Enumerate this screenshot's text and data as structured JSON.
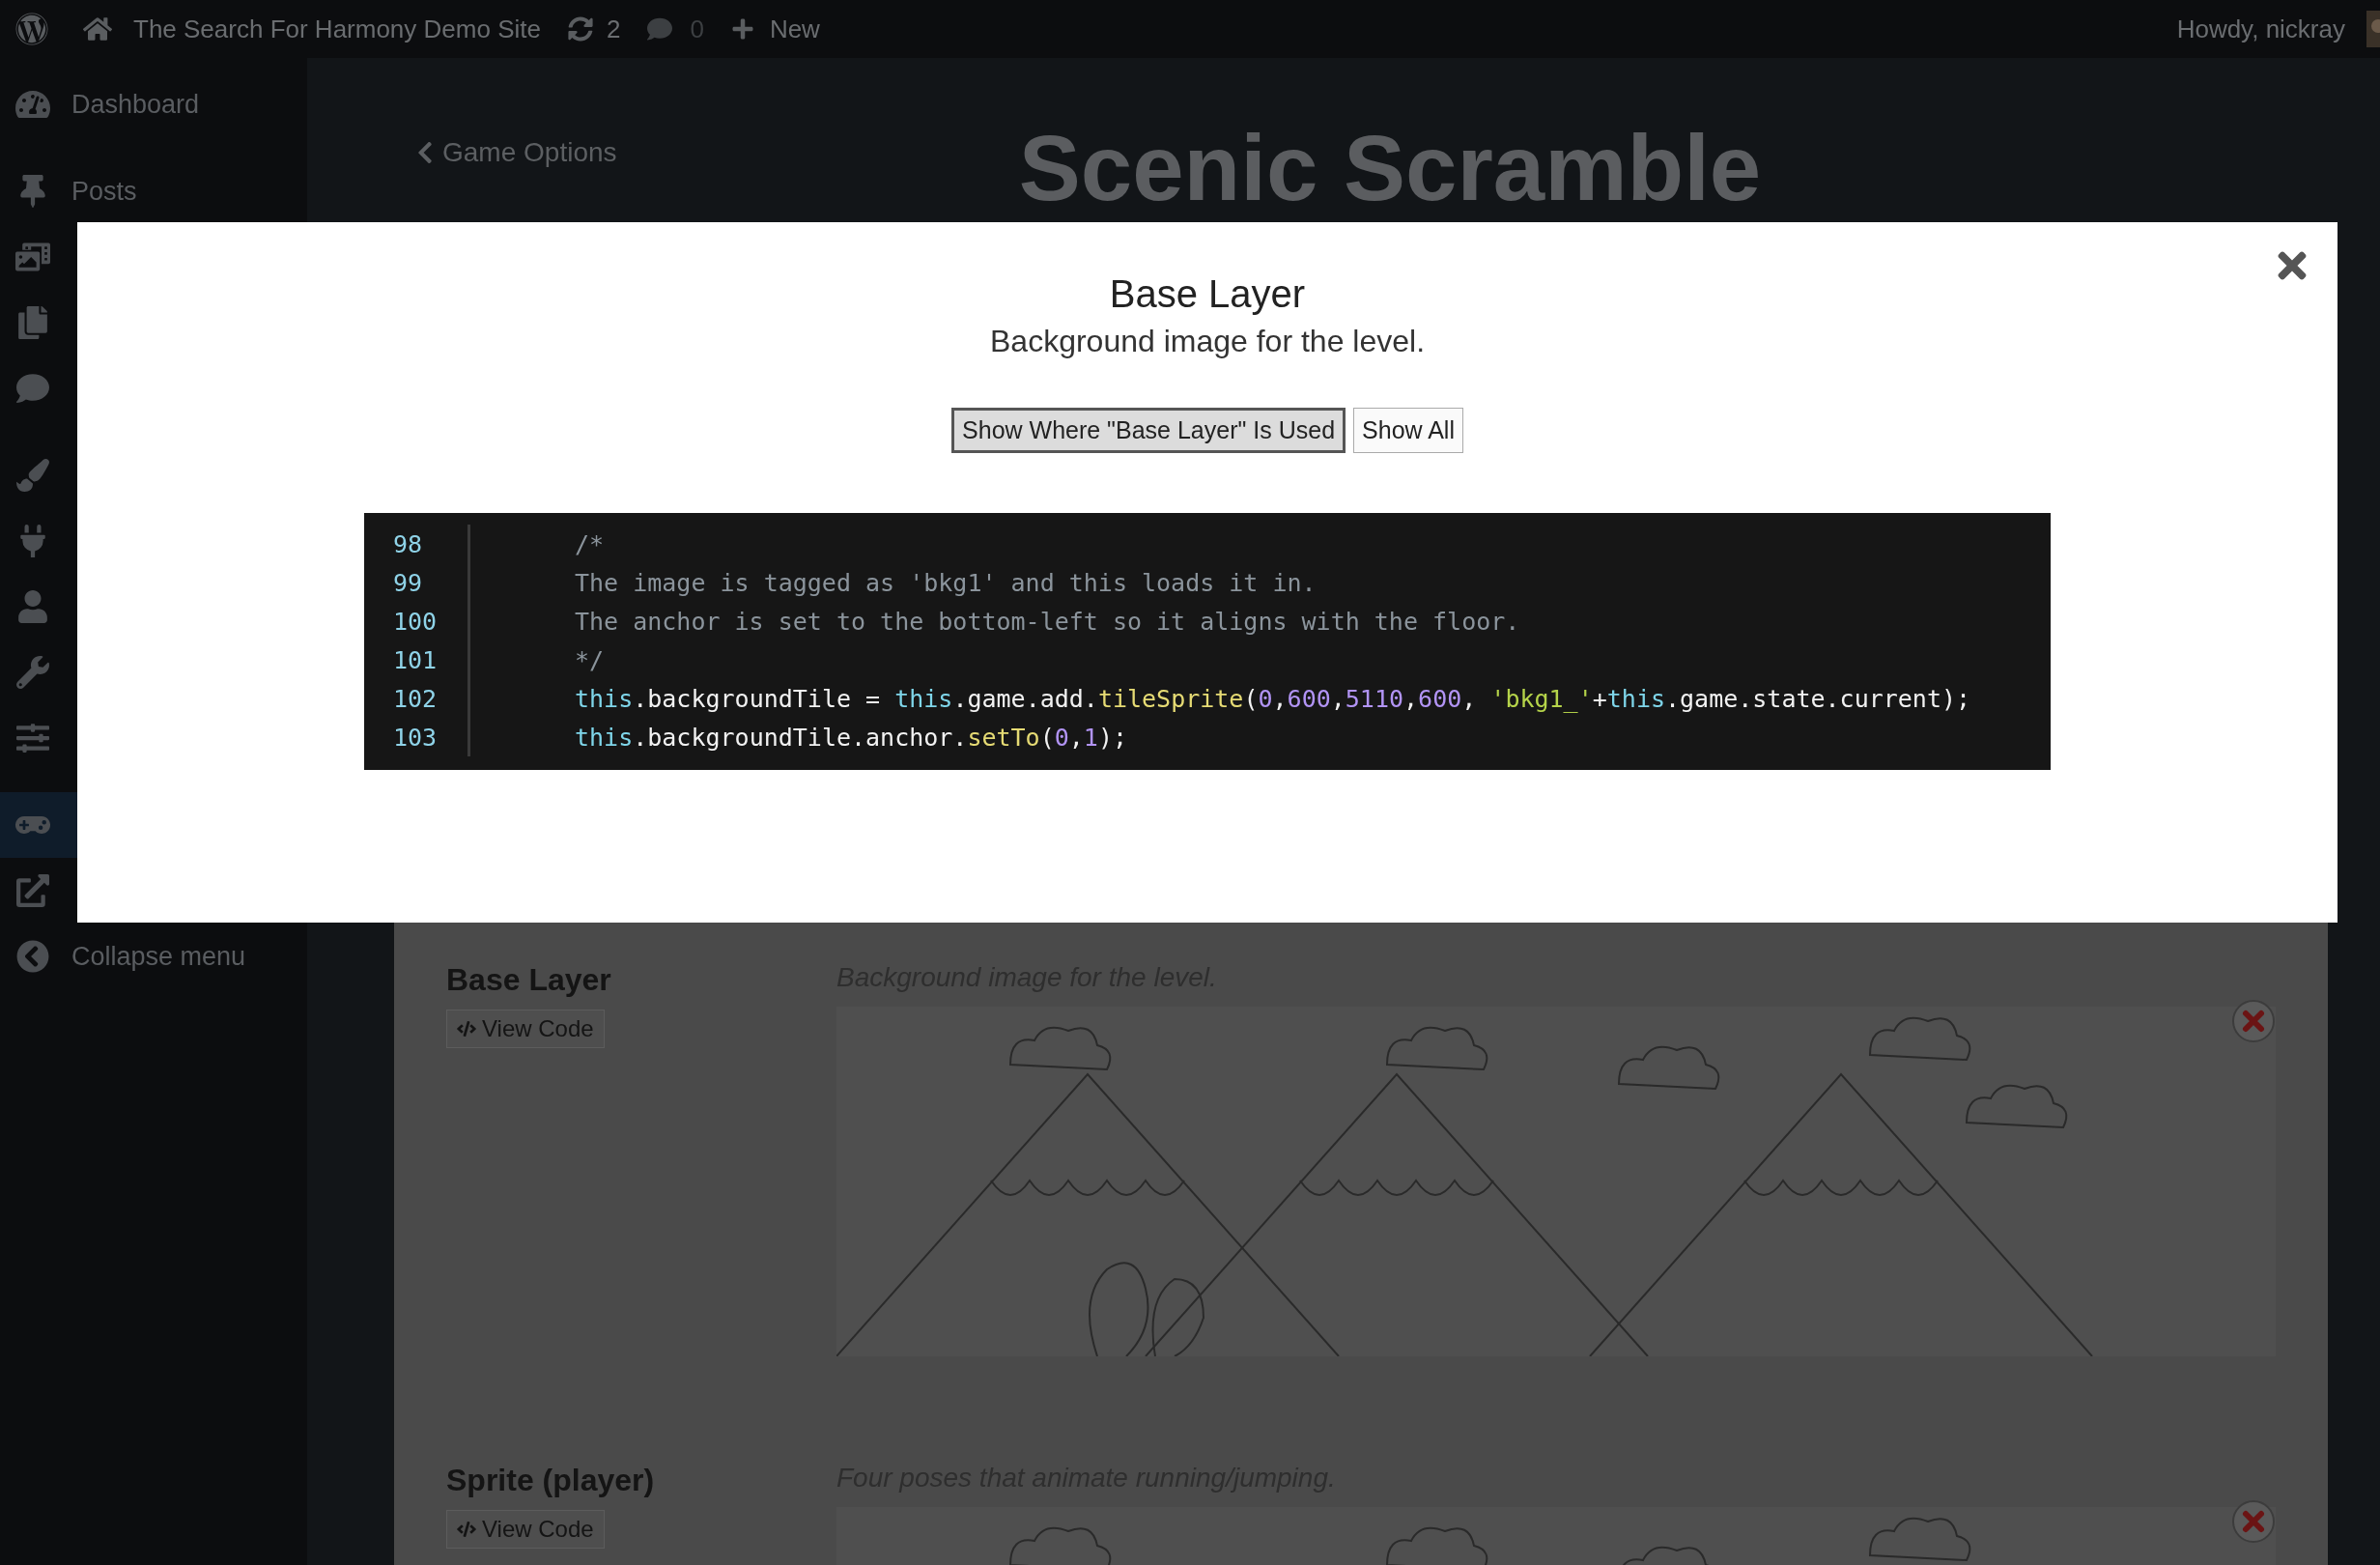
{
  "admin_bar": {
    "site_name": "The Search For Harmony Demo Site",
    "updates_count": "2",
    "comments_count": "0",
    "new_label": "New",
    "greeting": "Howdy, nickray"
  },
  "sidebar": {
    "groups": [
      {
        "items": [
          {
            "label": "Dashboard",
            "selected": false
          }
        ]
      },
      {
        "items": [
          {
            "label": "Posts",
            "selected": false
          },
          {
            "selected": false
          },
          {
            "selected": false
          },
          {
            "selected": false
          }
        ]
      },
      {
        "items": [
          {
            "selected": false
          },
          {
            "selected": false
          },
          {
            "selected": false
          },
          {
            "selected": false
          },
          {
            "selected": false
          }
        ]
      },
      {
        "items": [
          {
            "selected": true
          },
          {
            "selected": false
          },
          {
            "label": "Collapse menu",
            "selected": false
          }
        ]
      }
    ]
  },
  "page": {
    "back_link": "Game Options",
    "title": "Scenic Scramble",
    "assets": [
      {
        "name": "Base Layer",
        "button": "View Code",
        "description": "Background image for the level."
      },
      {
        "name": "Sprite (player)",
        "button": "View Code",
        "description": "Four poses that animate running/jumping."
      }
    ]
  },
  "modal": {
    "title": "Base Layer",
    "subtitle": "Background image for the level.",
    "buttons": [
      {
        "label": "Show Where \"Base Layer\" Is Used",
        "selected": true
      },
      {
        "label": "Show All",
        "selected": false
      }
    ],
    "code_lines": [
      {
        "number": "98",
        "tokens": [
          {
            "kind": "comment",
            "text": "/*"
          }
        ]
      },
      {
        "number": "99",
        "tokens": [
          {
            "kind": "comment",
            "text": "The image is tagged as 'bkg1' and this loads it in."
          }
        ]
      },
      {
        "number": "100",
        "tokens": [
          {
            "kind": "comment",
            "text": "The anchor is set to the bottom-left so it aligns with the floor."
          }
        ]
      },
      {
        "number": "101",
        "tokens": [
          {
            "kind": "comment",
            "text": "*/"
          }
        ]
      },
      {
        "number": "102",
        "tokens": [
          {
            "kind": "keyword",
            "text": "this"
          },
          {
            "kind": "plain",
            "text": ".backgroundTile = "
          },
          {
            "kind": "keyword",
            "text": "this"
          },
          {
            "kind": "plain",
            "text": ".game.add."
          },
          {
            "kind": "function",
            "text": "tileSprite"
          },
          {
            "kind": "plain",
            "text": "("
          },
          {
            "kind": "number",
            "text": "0"
          },
          {
            "kind": "plain",
            "text": ","
          },
          {
            "kind": "number",
            "text": "600"
          },
          {
            "kind": "plain",
            "text": ","
          },
          {
            "kind": "number",
            "text": "5110"
          },
          {
            "kind": "plain",
            "text": ","
          },
          {
            "kind": "number",
            "text": "600"
          },
          {
            "kind": "plain",
            "text": ", "
          },
          {
            "kind": "string",
            "text": "'bkg1_'"
          },
          {
            "kind": "plain",
            "text": "+"
          },
          {
            "kind": "keyword",
            "text": "this"
          },
          {
            "kind": "plain",
            "text": ".game.state.current);"
          }
        ]
      },
      {
        "number": "103",
        "tokens": [
          {
            "kind": "keyword",
            "text": "this"
          },
          {
            "kind": "plain",
            "text": ".backgroundTile.anchor."
          },
          {
            "kind": "function",
            "text": "setTo"
          },
          {
            "kind": "plain",
            "text": "("
          },
          {
            "kind": "number",
            "text": "0"
          },
          {
            "kind": "plain",
            "text": ","
          },
          {
            "kind": "number",
            "text": "1"
          },
          {
            "kind": "plain",
            "text": ");"
          }
        ]
      }
    ]
  }
}
